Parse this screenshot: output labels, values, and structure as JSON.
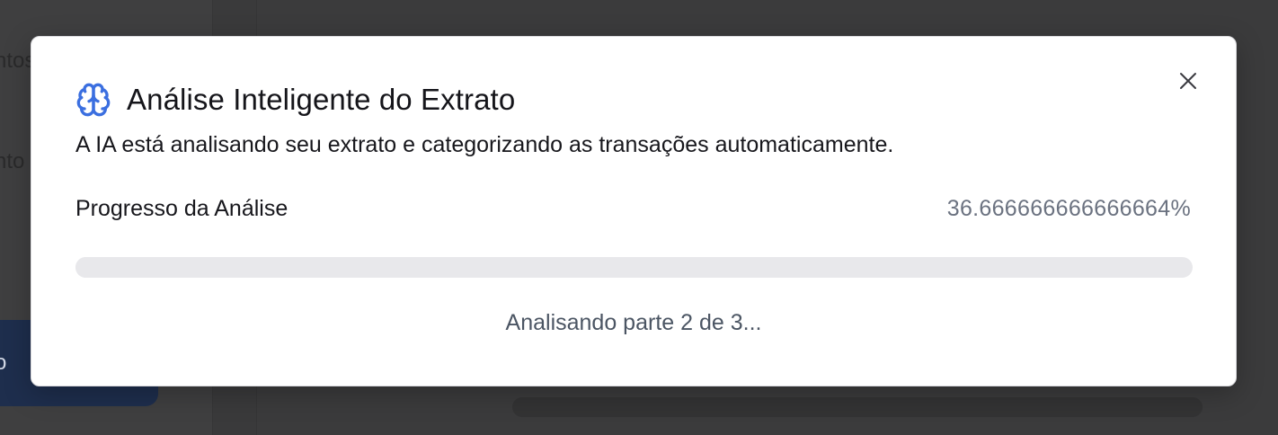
{
  "background": {
    "nav_item_1": "ntos",
    "nav_item_2": "nto",
    "active_button": "o"
  },
  "modal": {
    "icon": "brain-icon",
    "title": "Análise Inteligente do Extrato",
    "description": "A IA está analisando seu extrato e categorizando as transações automaticamente.",
    "close_icon": "close-icon",
    "progress": {
      "label": "Progresso da Análise",
      "value_text": "36.666666666666664%",
      "value": 36.666666666666664
    },
    "status": "Analisando parte 2 de 3..."
  },
  "colors": {
    "accent": "#3b6fe0",
    "title_text": "#15151a",
    "muted_text": "#6b7280",
    "track": "#e8e8eb"
  }
}
